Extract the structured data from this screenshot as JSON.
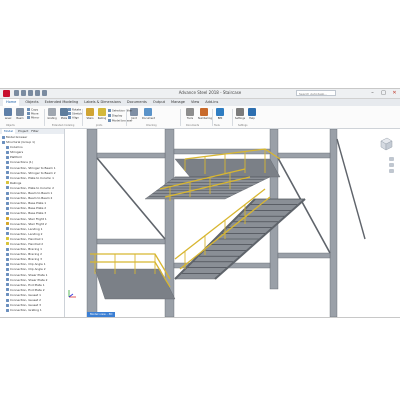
{
  "window": {
    "title": "Advance Steel 2018 - Staircase",
    "search_placeholder": "Search Autodesk..."
  },
  "window_controls": [
    "–",
    "□",
    "✕"
  ],
  "ribbon_tabs": [
    {
      "label": "Home",
      "active": true
    },
    {
      "label": "Objects"
    },
    {
      "label": "Extended Modeling"
    },
    {
      "label": "Labels & Dimensions"
    },
    {
      "label": "Documents"
    },
    {
      "label": "Output"
    },
    {
      "label": "Manage"
    },
    {
      "label": "View"
    },
    {
      "label": "Add-ins"
    }
  ],
  "ribbon": {
    "buttons": [
      {
        "label": "Level",
        "icon": "level-icon",
        "color": "#5e7fa8"
      },
      {
        "label": "Beam",
        "icon": "beam-icon",
        "color": "#7d8ea3"
      },
      {
        "label": "Grating",
        "icon": "grating-icon",
        "color": "#a0a7b0"
      },
      {
        "label": "Plate",
        "icon": "plate-icon",
        "color": "#5f7d9c"
      },
      {
        "label": "Stairs",
        "icon": "stairs-icon",
        "color": "#d0a433"
      },
      {
        "label": "Railing",
        "icon": "railing-icon",
        "color": "#d3b83b"
      },
      {
        "label": "Joint",
        "icon": "joint-icon",
        "color": "#7f8fa5"
      },
      {
        "label": "Document",
        "icon": "document-icon",
        "color": "#5a93c9"
      },
      {
        "label": "Tools",
        "icon": "tools-icon",
        "color": "#8d8d8d"
      },
      {
        "label": "Numbering",
        "icon": "numbering-icon",
        "color": "#c86a2b"
      },
      {
        "label": "BIM",
        "icon": "bim-icon",
        "color": "#2f7dc2"
      },
      {
        "label": "Settings",
        "icon": "settings-icon",
        "color": "#7b7b7b"
      },
      {
        "label": "Help",
        "icon": "help-icon",
        "color": "#2d6fb0"
      }
    ],
    "small_items": [
      "Copy",
      "Move",
      "Mirror",
      "Rotate",
      "Stretch",
      "Align",
      "Selection filter",
      "Display",
      "Model browser"
    ],
    "groups": [
      "Objects",
      "Extended modeling",
      "Joints",
      "Checking",
      "Documents",
      "Tools",
      "Settings"
    ]
  },
  "model_browser": {
    "tabs": [
      {
        "label": "Model",
        "active": true
      },
      {
        "label": "Project"
      },
      {
        "label": "Filter"
      }
    ],
    "rows": [
      {
        "label": "Model browser",
        "icon": "folder-icon"
      },
      {
        "label": "Structural (Group 1)",
        "icon": "structure-icon"
      },
      {
        "label": "Columns",
        "icon": "beam-icon"
      },
      {
        "label": "Stringers",
        "icon": "beam-icon"
      },
      {
        "label": "Platform",
        "icon": "plate-icon"
      },
      {
        "label": "Connections (1)",
        "icon": "joint-icon"
      },
      {
        "label": "Connection, Stringer to Beam 1",
        "icon": "joint-icon"
      },
      {
        "label": "Connection, Stringer to Beam 2",
        "icon": "joint-icon"
      },
      {
        "label": "Connection, Plate to Column 1",
        "icon": "joint-icon"
      },
      {
        "label": "Railings",
        "icon": "railing-icon"
      },
      {
        "label": "Connection, Plate to Column 2",
        "icon": "joint-icon"
      },
      {
        "label": "Connection, Beam to Beam 1",
        "icon": "joint-icon"
      },
      {
        "label": "Connection, Beam to Beam 2",
        "icon": "joint-icon"
      },
      {
        "label": "Connection, Base Plate 1",
        "icon": "joint-icon"
      },
      {
        "label": "Connection, Base Plate 2",
        "icon": "joint-icon"
      },
      {
        "label": "Connection, Base Plate 3",
        "icon": "joint-icon"
      },
      {
        "label": "Connection, Stair Flight 1",
        "icon": "stairs-icon"
      },
      {
        "label": "Connection, Stair Flight 2",
        "icon": "stairs-icon"
      },
      {
        "label": "Connection, Landing 1",
        "icon": "plate-icon"
      },
      {
        "label": "Connection, Landing 2",
        "icon": "plate-icon"
      },
      {
        "label": "Connection, Handrail 1",
        "icon": "railing-icon"
      },
      {
        "label": "Connection, Handrail 2",
        "icon": "railing-icon"
      },
      {
        "label": "Connection, Bracing 1",
        "icon": "joint-icon"
      },
      {
        "label": "Connection, Bracing 2",
        "icon": "joint-icon"
      },
      {
        "label": "Connection, Bracing 3",
        "icon": "joint-icon"
      },
      {
        "label": "Connection, Clip Angle 1",
        "icon": "joint-icon"
      },
      {
        "label": "Connection, Clip Angle 2",
        "icon": "joint-icon"
      },
      {
        "label": "Connection, Shear Plate 1",
        "icon": "joint-icon"
      },
      {
        "label": "Connection, Shear Plate 2",
        "icon": "joint-icon"
      },
      {
        "label": "Connection, End Plate 1",
        "icon": "joint-icon"
      },
      {
        "label": "Connection, End Plate 2",
        "icon": "joint-icon"
      },
      {
        "label": "Connection, Gusset 1",
        "icon": "joint-icon"
      },
      {
        "label": "Connection, Gusset 2",
        "icon": "joint-icon"
      },
      {
        "label": "Connection, Gusset 3",
        "icon": "joint-icon"
      },
      {
        "label": "Connection, Grating 1",
        "icon": "grating-icon"
      }
    ]
  },
  "viewport": {
    "tab_label": "Model view - 3D",
    "colors": {
      "steel": "#9aa0a8",
      "steel_dark": "#5f646b",
      "railing": "#d8b630",
      "grating": "#7b8087"
    }
  }
}
